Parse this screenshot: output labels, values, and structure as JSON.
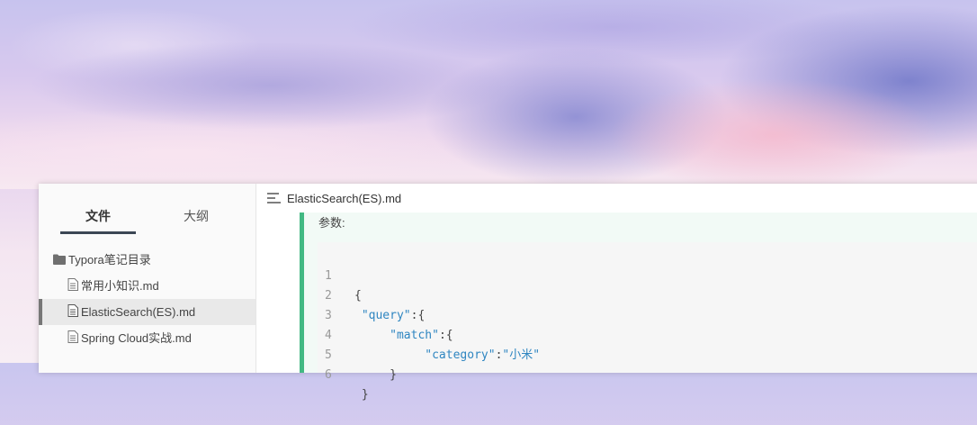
{
  "sidebar": {
    "tabs": [
      "文件",
      "大纲"
    ],
    "tree": {
      "folder": "Typora笔记目录",
      "files": [
        "常用小知识.md",
        "ElasticSearch(ES).md",
        "Spring Cloud实战.md"
      ]
    }
  },
  "editor": {
    "title": "ElasticSearch(ES).md",
    "quote_label": "参数:",
    "code": {
      "line_numbers": [
        "1",
        "2",
        "3",
        "4",
        "5",
        "6"
      ],
      "lines": [
        {
          "pre": "{",
          "key": "",
          "mid": "",
          "val": "",
          "post": ""
        },
        {
          "pre": " ",
          "key": "\"query\"",
          "mid": ":{",
          "val": "",
          "post": ""
        },
        {
          "pre": "     ",
          "key": "\"match\"",
          "mid": ":{",
          "val": "",
          "post": ""
        },
        {
          "pre": "          ",
          "key": "\"category\"",
          "mid": ":",
          "val": "\"小米\"",
          "post": ""
        },
        {
          "pre": "     }",
          "key": "",
          "mid": "",
          "val": "",
          "post": ""
        },
        {
          "pre": " }",
          "key": "",
          "mid": "",
          "val": "",
          "post": ""
        }
      ]
    }
  },
  "colors": {
    "accent": "#42b983",
    "string": "#2f86c1",
    "active_bar": "#3c4654"
  },
  "icons": [
    "folder-icon",
    "file-icon",
    "menu-icon",
    "minimize-icon"
  ]
}
